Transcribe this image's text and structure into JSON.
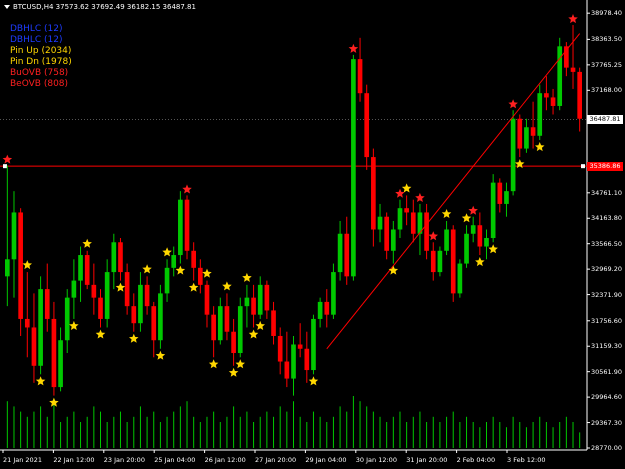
{
  "chart": {
    "title": "BTCUSD,H4  37573.62 37692.49 36182.15 36487.81",
    "colors": {
      "background": "#000000",
      "bull": "#00C800",
      "bear": "#FF0000",
      "volume": "#00C800",
      "trendline": "#FF0000",
      "hline": "#FF0000",
      "star_up": "#FFD700",
      "star_dn": "#FF2020",
      "axis": "#FFFFFF",
      "current_price_box": "#FFFFFF"
    }
  },
  "legend": [
    {
      "label": "DBHLC (12)",
      "color": "#1E3CFF"
    },
    {
      "label": "DBHLC (12)",
      "color": "#1E3CFF"
    },
    {
      "label": "Pin Up (2034)",
      "color": "#FFD700"
    },
    {
      "label": "Pin Dn (1978)",
      "color": "#FFD700"
    },
    {
      "label": "BuOVB (758)",
      "color": "#FF2020"
    },
    {
      "label": "BeOVB (808)",
      "color": "#FF2020"
    }
  ],
  "price_axis": {
    "labels": [
      "38978.40",
      "38363.50",
      "37765.25",
      "37168.00",
      "36487.81",
      "35386.86",
      "34761.10",
      "34163.80",
      "33566.50",
      "32969.20",
      "32371.90",
      "31756.60",
      "31159.30",
      "30561.90",
      "29964.60",
      "29367.30",
      "28770.00"
    ],
    "current_price": "36487.81",
    "hline_price": "35386.86"
  },
  "time_axis": {
    "labels": [
      "21 Jan 2021",
      "22 Jan 12:00",
      "23 Jan 20:00",
      "25 Jan 04:00",
      "26 Jan 12:00",
      "27 Jan 20:00",
      "29 Jan 04:00",
      "30 Jan 12:00",
      "31 Jan 20:00",
      "2 Feb 04:00",
      "3 Feb 12:00"
    ]
  },
  "chart_data": {
    "type": "candlestick",
    "symbol": "BTCUSD",
    "timeframe": "H4",
    "ylim": [
      28770,
      39100
    ],
    "candles": [
      [
        32800,
        35400,
        32100,
        33200
      ],
      [
        33200,
        34800,
        32300,
        34300
      ],
      [
        34300,
        34400,
        31400,
        31800
      ],
      [
        31800,
        32900,
        30900,
        31600
      ],
      [
        31600,
        32400,
        30300,
        30700
      ],
      [
        30700,
        32800,
        30500,
        32500
      ],
      [
        32500,
        33100,
        31500,
        31800
      ],
      [
        31800,
        32200,
        30000,
        30200
      ],
      [
        30200,
        31600,
        30100,
        31300
      ],
      [
        31300,
        32500,
        31000,
        32300
      ],
      [
        32300,
        33200,
        31800,
        32700
      ],
      [
        32700,
        33500,
        32200,
        33300
      ],
      [
        33300,
        33400,
        32500,
        32600
      ],
      [
        32600,
        33100,
        31900,
        32300
      ],
      [
        32300,
        32500,
        31600,
        31800
      ],
      [
        31800,
        33200,
        31600,
        32900
      ],
      [
        32900,
        33800,
        32500,
        33600
      ],
      [
        33600,
        33700,
        32700,
        32900
      ],
      [
        32900,
        33100,
        31900,
        32100
      ],
      [
        32100,
        32400,
        31500,
        31700
      ],
      [
        31700,
        32900,
        31500,
        32600
      ],
      [
        32600,
        32800,
        31900,
        32100
      ],
      [
        32100,
        32200,
        30900,
        31300
      ],
      [
        31300,
        32600,
        31100,
        32400
      ],
      [
        32400,
        33200,
        32200,
        33000
      ],
      [
        33000,
        33500,
        32800,
        33300
      ],
      [
        33300,
        34800,
        33100,
        34600
      ],
      [
        34600,
        34700,
        33200,
        33400
      ],
      [
        33400,
        33600,
        32700,
        33000
      ],
      [
        33000,
        33200,
        32400,
        32600
      ],
      [
        32600,
        32700,
        31600,
        31900
      ],
      [
        31900,
        32100,
        30900,
        31300
      ],
      [
        31300,
        32300,
        31200,
        32100
      ],
      [
        32100,
        32400,
        31300,
        31500
      ],
      [
        31500,
        31800,
        30700,
        31000
      ],
      [
        31000,
        32300,
        30900,
        32100
      ],
      [
        32100,
        32600,
        31600,
        32300
      ],
      [
        32300,
        32600,
        31600,
        31900
      ],
      [
        31900,
        32800,
        31800,
        32600
      ],
      [
        32600,
        32700,
        31800,
        32000
      ],
      [
        32000,
        32200,
        31200,
        31400
      ],
      [
        31400,
        31600,
        30500,
        30800
      ],
      [
        30800,
        31500,
        30200,
        30400
      ],
      [
        30400,
        31400,
        30000,
        31200
      ],
      [
        31200,
        31700,
        30900,
        31100
      ],
      [
        31100,
        31500,
        30300,
        30600
      ],
      [
        30600,
        31900,
        30500,
        31800
      ],
      [
        31800,
        32300,
        31600,
        32200
      ],
      [
        32200,
        32500,
        31600,
        31900
      ],
      [
        31900,
        33100,
        31800,
        32900
      ],
      [
        32900,
        34100,
        32700,
        33800
      ],
      [
        33800,
        34200,
        32600,
        32800
      ],
      [
        32800,
        38000,
        32700,
        37900
      ],
      [
        37900,
        38400,
        36900,
        37100
      ],
      [
        37100,
        37300,
        35300,
        35600
      ],
      [
        35600,
        35800,
        33500,
        33900
      ],
      [
        33900,
        34500,
        33600,
        34200
      ],
      [
        34200,
        34300,
        33200,
        33400
      ],
      [
        33400,
        34100,
        33100,
        33900
      ],
      [
        33900,
        34600,
        33700,
        34400
      ],
      [
        34400,
        34700,
        34000,
        34300
      ],
      [
        34300,
        34600,
        33600,
        33800
      ],
      [
        33800,
        34500,
        33300,
        34300
      ],
      [
        34300,
        34500,
        33200,
        33400
      ],
      [
        33400,
        33600,
        32700,
        32900
      ],
      [
        32900,
        33500,
        32800,
        33400
      ],
      [
        33400,
        34100,
        33300,
        33900
      ],
      [
        33900,
        34000,
        32200,
        32400
      ],
      [
        32400,
        33200,
        32300,
        33100
      ],
      [
        33100,
        34000,
        33000,
        33800
      ],
      [
        33800,
        34200,
        33600,
        34000
      ],
      [
        34000,
        34300,
        33300,
        33500
      ],
      [
        33500,
        33900,
        33200,
        33700
      ],
      [
        33700,
        35200,
        33600,
        35000
      ],
      [
        35000,
        35100,
        34300,
        34500
      ],
      [
        34500,
        35000,
        34200,
        34800
      ],
      [
        34800,
        36700,
        34700,
        36500
      ],
      [
        36500,
        36600,
        35600,
        35800
      ],
      [
        35800,
        36500,
        35700,
        36300
      ],
      [
        36300,
        36900,
        35800,
        36100
      ],
      [
        36100,
        37300,
        36000,
        37100
      ],
      [
        37100,
        37500,
        36700,
        37000
      ],
      [
        37000,
        37200,
        36600,
        36800
      ],
      [
        36800,
        38400,
        36700,
        38200
      ],
      [
        38200,
        38300,
        37500,
        37700
      ],
      [
        37700,
        38700,
        37200,
        37600
      ],
      [
        37600,
        37700,
        36200,
        36500
      ]
    ],
    "volume_relative": [
      0.9,
      0.8,
      0.7,
      0.6,
      0.7,
      0.8,
      0.6,
      0.9,
      0.5,
      0.6,
      0.7,
      0.5,
      0.6,
      0.8,
      0.7,
      0.5,
      0.6,
      0.7,
      0.5,
      0.6,
      0.8,
      0.6,
      0.7,
      0.5,
      0.6,
      0.7,
      0.8,
      0.9,
      0.6,
      0.5,
      0.6,
      0.7,
      0.5,
      0.6,
      0.8,
      0.6,
      0.7,
      0.5,
      0.6,
      0.7,
      0.6,
      0.8,
      0.7,
      0.9,
      0.6,
      0.5,
      0.7,
      0.6,
      0.5,
      0.6,
      0.8,
      0.7,
      1.0,
      0.9,
      0.8,
      0.7,
      0.6,
      0.5,
      0.6,
      0.7,
      0.5,
      0.6,
      0.7,
      0.5,
      0.6,
      0.5,
      0.6,
      0.7,
      0.5,
      0.6,
      0.5,
      0.4,
      0.5,
      0.6,
      0.5,
      0.4,
      0.6,
      0.5,
      0.4,
      0.5,
      0.6,
      0.5,
      0.4,
      0.5,
      0.6,
      0.5,
      0.3
    ],
    "trendline": [
      [
        48,
        31100
      ],
      [
        86,
        38500
      ]
    ],
    "hline": 35386.86
  }
}
